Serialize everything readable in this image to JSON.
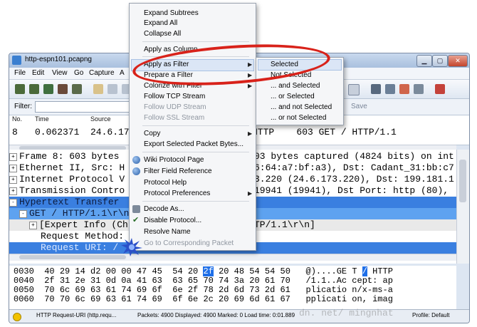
{
  "window": {
    "title": "http-espn101.pcapng",
    "buttons": [
      "▁",
      "▢",
      "✕"
    ]
  },
  "menubar": [
    "File",
    "Edit",
    "View",
    "Go",
    "Capture",
    "A"
  ],
  "filter": {
    "label": "Filter:",
    "save_label": "Save"
  },
  "packet_list": {
    "headers": [
      "No.",
      "Time",
      "Source"
    ],
    "row": {
      "no": "8",
      "time": "0.062371",
      "source": "24.6.17",
      "tail": "HTTP    603 GET / HTTP/1.1"
    }
  },
  "details": [
    {
      "expander": "+",
      "text": "Frame 8: 603 bytes",
      "right": "03 bytes captured (4824 bits) on int"
    },
    {
      "expander": "+",
      "text": "Ethernet II, Src: H",
      "right": "6:64:a7:bf:a3), Dst: Cadant_31:bb:c7"
    },
    {
      "expander": "+",
      "text": "Internet Protocol V",
      "right": "3.220 (24.6.173.220), Dst: 199.181.1"
    },
    {
      "expander": "+",
      "text": "Transmission Contro",
      "right": "19941 (19941), Dst Port: http (80),"
    },
    {
      "expander": "-",
      "text": "Hypertext Transfer",
      "right": ""
    },
    {
      "expander": "-",
      "text": "GET / HTTP/1.1\\r\\n",
      "right": ""
    },
    {
      "expander": "+",
      "text": "[Expert Info (Ch",
      "right": "TP/1.1\\r\\n]"
    },
    {
      "expander": "",
      "text": "Request Method:",
      "right": ""
    },
    {
      "expander": "",
      "text": "Request URI: /",
      "right": ""
    }
  ],
  "bytes": [
    {
      "offset": "0030",
      "hex_a": "40 29 14 d2 00 00 47 45  54 20 ",
      "hex_hl": "2f",
      "hex_b": " 20 48 54 54 50",
      "ascii_a": "@)....GE T ",
      "ascii_hl": "/",
      "ascii_b": " HTTP"
    },
    {
      "offset": "0040",
      "hex_a": "2f 31 2e 31 0d 0a 41 63  63 65 70 74 3a 20 61 70",
      "hex_hl": "",
      "hex_b": "",
      "ascii_a": "/1.1..Ac cept: ap",
      "ascii_hl": "",
      "ascii_b": ""
    },
    {
      "offset": "0050",
      "hex_a": "70 6c 69 63 61 74 69 6f  6e 2f 78 2d 6d 73 2d 61",
      "hex_hl": "",
      "hex_b": "",
      "ascii_a": "plicatio n/x-ms-a",
      "ascii_hl": "",
      "ascii_b": ""
    },
    {
      "offset": "0060",
      "hex_a": "70 70 6c 69 63 61 74 69  6f 6e 2c 20 69 6d 61 67",
      "hex_hl": "",
      "hex_b": "",
      "ascii_a": "pplicati on, imag",
      "ascii_hl": "",
      "ascii_b": ""
    }
  ],
  "status": {
    "field": "HTTP Request-URI (http.requ...",
    "packets": "Packets: 4900 Displayed: 4900 Marked: 0 Load time: 0:01.889",
    "profile": "Profile: Default"
  },
  "context_menu": {
    "items": [
      {
        "label": "Expand Subtrees",
        "disabled": true
      },
      {
        "label": "Expand All",
        "disabled": false
      },
      {
        "label": "Collapse All",
        "disabled": false
      },
      {
        "label": "Apply as Column",
        "disabled": false
      },
      {
        "label": "Apply as Filter",
        "disabled": false,
        "submenu": true
      },
      {
        "label": "Prepare a Filter",
        "disabled": false,
        "submenu": true
      },
      {
        "label": "Colorize with Filter",
        "disabled": false,
        "submenu": true
      },
      {
        "label": "Follow TCP Stream",
        "disabled": false
      },
      {
        "label": "Follow UDP Stream",
        "disabled": true
      },
      {
        "label": "Follow SSL Stream",
        "disabled": true
      },
      {
        "label": "Copy",
        "disabled": false,
        "submenu": true
      },
      {
        "label": "Export Selected Packet Bytes...",
        "disabled": false
      },
      {
        "label": "Wiki Protocol Page",
        "disabled": false,
        "icon": "globe-icon"
      },
      {
        "label": "Filter Field Reference",
        "disabled": false,
        "icon": "globe-icon"
      },
      {
        "label": "Protocol Help",
        "disabled": false
      },
      {
        "label": "Protocol Preferences",
        "disabled": false,
        "submenu": true
      },
      {
        "label": "Decode As...",
        "disabled": false,
        "icon": "decode-icon"
      },
      {
        "label": "Disable Protocol...",
        "disabled": false,
        "icon": "check-icon"
      },
      {
        "label": "Resolve Name",
        "disabled": false
      },
      {
        "label": "Go to Corresponding Packet",
        "disabled": true
      }
    ]
  },
  "filter_submenu": {
    "items": [
      "Selected",
      "Not Selected",
      "... and Selected",
      "... or Selected",
      "... and not Selected",
      "... or not Selected"
    ]
  },
  "watermark": "dn. net/       mingnhat"
}
